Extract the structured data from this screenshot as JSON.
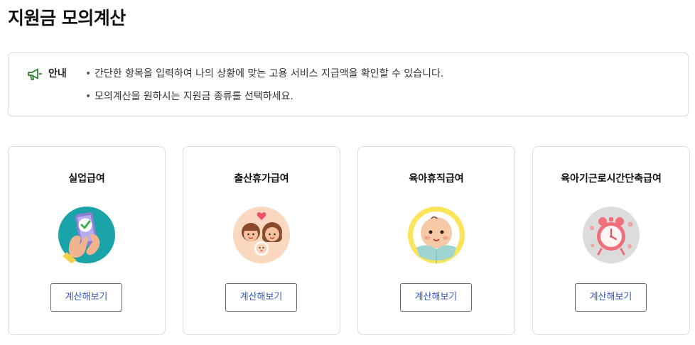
{
  "page": {
    "title": "지원금 모의계산"
  },
  "notice": {
    "label": "안내",
    "icon": "megaphone-icon",
    "icon_color": "#2e7d32",
    "bullet": "•",
    "items": [
      "간단한 항목을 입력하여 나의 상황에 맞는 고용 서비스 지급액을 확인할 수 있습니다.",
      "모의계산을 원하시는 지원금 종류를 선택하세요."
    ]
  },
  "cards": [
    {
      "title": "실업급여",
      "image": "phone-checkmark-illustration",
      "image_bg": "#1aa3a8",
      "button_label": "계산해보기"
    },
    {
      "title": "출산휴가급여",
      "image": "parents-baby-illustration",
      "image_bg": "#fbd9c0",
      "button_label": "계산해보기"
    },
    {
      "title": "육아휴직급여",
      "image": "swaddled-baby-illustration",
      "image_bg": "#fbe35a",
      "button_label": "계산해보기"
    },
    {
      "title": "육아기근로시간단축급여",
      "image": "alarm-clock-illustration",
      "image_bg": "#dcdcdc",
      "button_label": "계산해보기"
    }
  ],
  "colors": {
    "button_text": "#3557c9",
    "border": "#dcdcdc"
  }
}
